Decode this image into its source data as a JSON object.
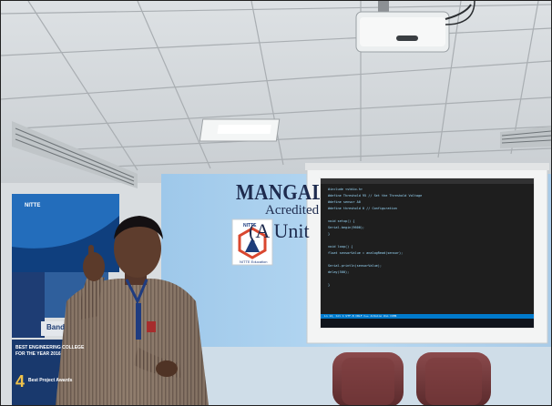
{
  "wall_sign": {
    "line1": "MANGALORE",
    "line2": "Acredited b",
    "line3": "(A Unit"
  },
  "logo": {
    "title": "NITTE",
    "caption": "NITTE Education"
  },
  "banner_left": {
    "title": "NITTE"
  },
  "poster": {
    "line1": "BEST ENGINEERING COLLEGE",
    "line2": "FOR THE YEAR 2016",
    "award_number": "4",
    "award_text": "Best Project Awards",
    "band_text": "Band"
  },
  "projected_code": {
    "lines": [
      "#include <stdio.h>",
      "#define Threshold 95 // Set the Threshold Voltage",
      "#define sensor A0",
      "#define threshold 0 // Configuration",
      "",
      "void setup() {",
      "  Serial.begin(9600);",
      "}",
      "",
      "void loop() {",
      "  float sensorValue = analogRead(sensor);",
      "",
      "  Serial.println(sensorValue);",
      "  delay(500);",
      "",
      "}"
    ],
    "status": "Ln 12, Col 1   UTF-8   CRLF   C++   Arduino Uno   COM4"
  }
}
